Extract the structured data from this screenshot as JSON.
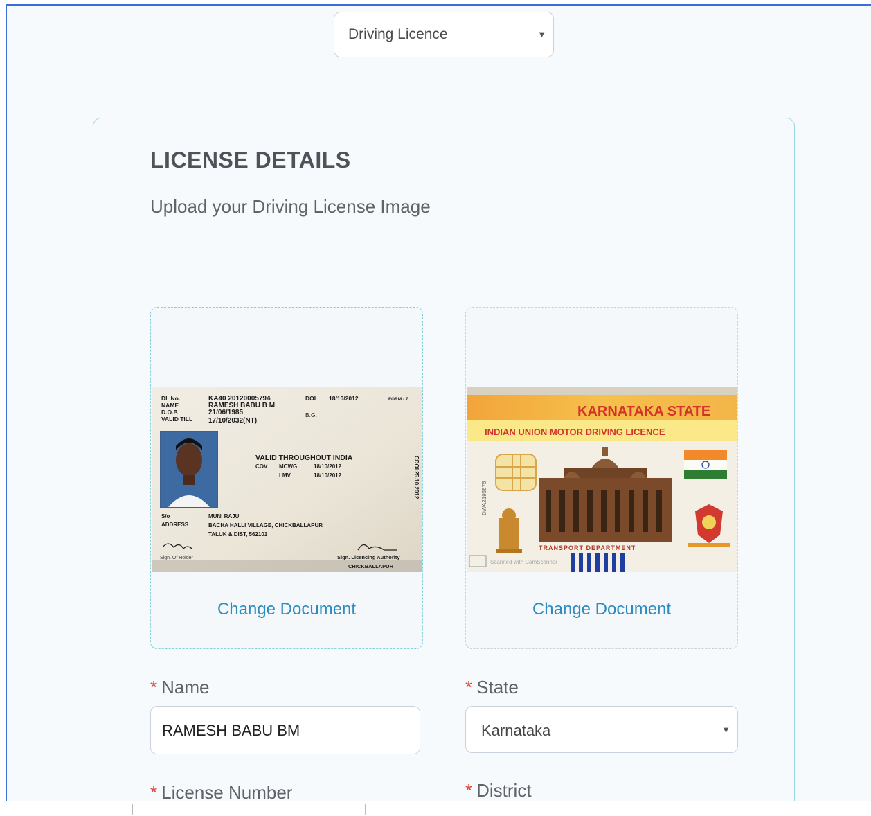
{
  "document_select": {
    "value": "Driving Licence"
  },
  "card": {
    "title": "LICENSE DETAILS",
    "subtitle": "Upload your Driving License Image"
  },
  "uploads": [
    {
      "action": "Change Document"
    },
    {
      "action": "Change Document"
    }
  ],
  "license_front": {
    "dl_no_label": "DL No.",
    "dl_no": "KA40 20120005794",
    "name_label": "NAME",
    "name": "RAMESH BABU B M",
    "dob_label": "D.O.B",
    "dob": "21/06/1985",
    "valid_till_label": "VALID TILL",
    "valid_till": "17/10/2032(NT)",
    "doi_label": "DOI",
    "doi": "18/10/2012",
    "bg_label": "B.G.",
    "form": "FORM - 7",
    "validity": "VALID THROUGHOUT INDIA",
    "cov_label": "COV",
    "cov1": "MCWG",
    "cov1_date": "18/10/2012",
    "cov2": "LMV",
    "cov2_date": "18/10/2012",
    "so_label": "S/o",
    "so": "MUNI RAJU",
    "address_label": "ADDRESS",
    "address1": "BACHA HALLI VILLAGE, CHICKBALLAPUR",
    "address2": "TALUK & DIST, 562101",
    "holder_sign": "Sign. Of Holder",
    "authority": "Sign. Licencing Authority",
    "authority_place": "CHICKBALLAPUR",
    "side_stamp": "CDOI 25.10.2012"
  },
  "license_back": {
    "state_text": "KARNATAKA STATE",
    "licence_text": "INDIAN UNION MOTOR DRIVING LICENCE",
    "serial": "DWA2193876",
    "department": "TRANSPORT DEPARTMENT",
    "scanner": "Scanned with CamScanner"
  },
  "form": {
    "name_label": "Name",
    "name_value": "RAMESH BABU BM",
    "state_label": "State",
    "state_value": "Karnataka",
    "license_number_label": "License Number",
    "district_label": "District",
    "required_mark": "*"
  },
  "colors": {
    "accent": "#2e8bc0",
    "required": "#e0443a",
    "card_border": "#9ad8e6"
  }
}
